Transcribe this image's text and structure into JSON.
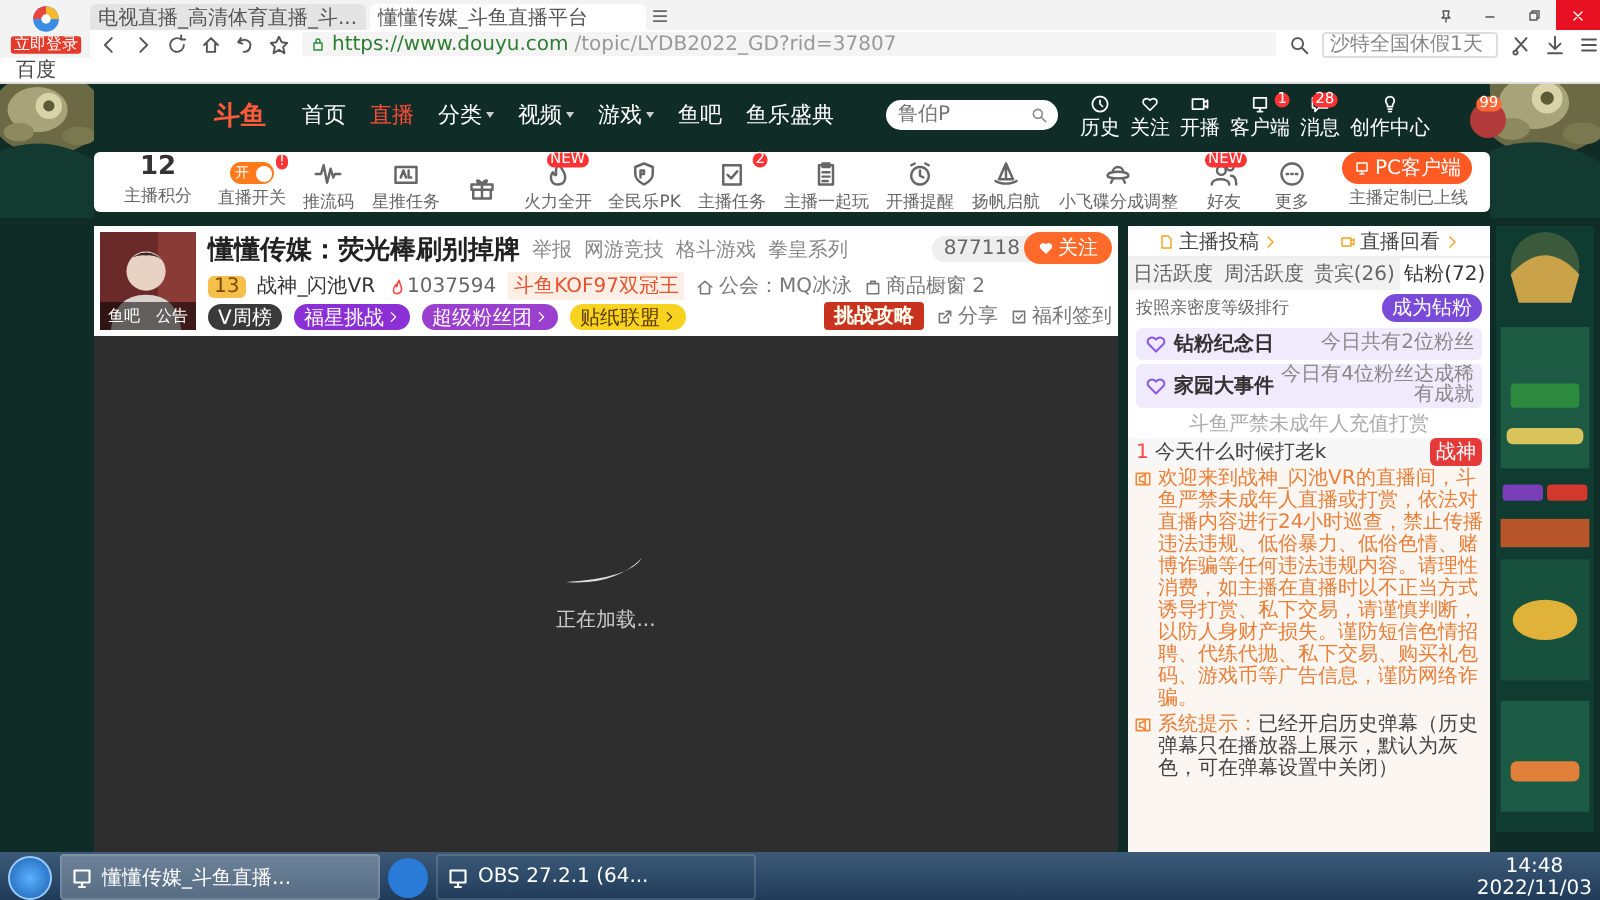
{
  "browser": {
    "login": "立即登录",
    "tabs": [
      {
        "title": "电视直播_高清体育直播_斗...",
        "selected": false
      },
      {
        "title": "懂懂传媒_斗鱼直播平台",
        "selected": true
      }
    ],
    "url": {
      "host": "https://www.douyu.com",
      "path": "/topic/LYDB2022_GD?rid=37807"
    },
    "search": {
      "placeholder": "沙特全国休假1天"
    },
    "bookmarks": [
      "百度"
    ]
  },
  "site": {
    "logo": "斗鱼",
    "nav": [
      {
        "label": "首页",
        "selected": false,
        "dropdown": false
      },
      {
        "label": "直播",
        "selected": true,
        "dropdown": false
      },
      {
        "label": "分类",
        "selected": false,
        "dropdown": true
      },
      {
        "label": "视频",
        "selected": false,
        "dropdown": true
      },
      {
        "label": "游戏",
        "selected": false,
        "dropdown": true
      },
      {
        "label": "鱼吧",
        "selected": false,
        "dropdown": false
      },
      {
        "label": "鱼乐盛典",
        "selected": false,
        "dropdown": false
      }
    ],
    "search": {
      "placeholder": "鲁伯P"
    },
    "actions": [
      {
        "kind": "clock",
        "label": "历史"
      },
      {
        "kind": "heart",
        "label": "关注"
      },
      {
        "kind": "camera",
        "label": "开播"
      },
      {
        "kind": "device",
        "label": "客户端",
        "badge": "1"
      },
      {
        "kind": "message",
        "label": "消息",
        "badge": "28"
      },
      {
        "kind": "bulb",
        "label": "创作中心"
      }
    ],
    "avatar_badge": "99"
  },
  "toolbar": {
    "score": {
      "value": "12",
      "label": "主播积分"
    },
    "items": [
      {
        "kind": "toggle",
        "label": "直播开关",
        "toggle_text": "开",
        "on": true,
        "badge": "!"
      },
      {
        "kind": "wave",
        "label": "推流码"
      },
      {
        "kind": "ad",
        "label": "星推任务"
      },
      {
        "kind": "gift"
      },
      {
        "kind": "flame",
        "label": "火力全开",
        "badge": "NEW"
      },
      {
        "kind": "pk",
        "label": "全民乐PK"
      },
      {
        "kind": "task",
        "label": "主播任务",
        "badge": "2"
      },
      {
        "kind": "clipboard",
        "label": "主播一起玩"
      },
      {
        "kind": "alarm",
        "label": "开播提醒"
      },
      {
        "kind": "sail",
        "label": "扬帆启航"
      },
      {
        "kind": "ufo",
        "label": "小飞碟分成调整"
      },
      {
        "kind": "friends",
        "label": "好友",
        "badge": "NEW"
      },
      {
        "kind": "more",
        "label": "更多"
      }
    ],
    "client_button": "PC客户端",
    "client_note": "主播定制已上线"
  },
  "room": {
    "avatar_links": [
      "鱼吧",
      "公告"
    ],
    "title": "懂懂传媒：荧光棒刷别掉牌",
    "report": "举报",
    "categories": [
      "网游竞技",
      "格斗游戏",
      "拳皇系列"
    ],
    "level": "13",
    "anchor": "战神_闪池VR",
    "heat": "1037594",
    "honor": "斗鱼KOF97双冠王",
    "guild": "公会：MQ冰泳",
    "shop": "商品橱窗 2",
    "badges": [
      {
        "label": "V周榜",
        "color": "#3a3a3a",
        "arrow": false
      },
      {
        "label": "福星挑战",
        "color": "#8b2fd6",
        "arrow": true
      },
      {
        "label": "超级粉丝团",
        "color": "#9b3fcf",
        "arrow": true
      },
      {
        "label": "贴纸联盟",
        "color": "#f7d21e",
        "arrow": true
      }
    ],
    "followers": "877118",
    "follow": "关注",
    "challenge": "挑战攻略",
    "share": "分享",
    "checkin": "福利签到",
    "video": {
      "status": "正在加载..."
    }
  },
  "chat": {
    "links": [
      "主播投稿",
      "直播回看"
    ],
    "tabs": [
      {
        "label": "日活跃度",
        "selected": false
      },
      {
        "label": "周活跃度",
        "selected": false
      },
      {
        "label": "贵宾(26)",
        "selected": false
      },
      {
        "label": "钻粉(72)",
        "selected": true
      }
    ],
    "rank_note": "按照亲密度等级排行",
    "join": "成为钻粉",
    "events": [
      {
        "title": "钻粉纪念日",
        "note": "今日共有2位粉丝"
      },
      {
        "title": "家园大事件",
        "note": "今日有4位粉丝达成稀有成就"
      }
    ],
    "notice": "斗鱼严禁未成年人充值打赏",
    "pinned": {
      "rank": "1",
      "text": "今天什么时候打老k",
      "tag": "战神"
    },
    "messages": [
      {
        "kind": "welcome",
        "text": "欢迎来到战神_闪池VR的直播间，斗鱼严禁未成年人直播或打赏，依法对直播内容进行24小时巡查，禁止传播违法违规、低俗暴力、低俗色情、赌博诈骗等任何违法违规内容。请理性消费，如主播在直播时以不正当方式诱导打赏、私下交易，请谨慎判断，以防人身财产损失。谨防短信色情招聘、代练代抛、私下交易、购买礼包码、游戏币等广告信息，谨防网络诈骗。"
      },
      {
        "kind": "system",
        "label": "系统提示：",
        "text": "已经开启历史弹幕（历史弹幕只在播放器上展示，默认为灰色，可在弹幕设置中关闭）"
      }
    ]
  },
  "taskbar": {
    "items": [
      {
        "label": "懂懂传媒_斗鱼直播...",
        "selected": true
      },
      {
        "label": "OBS 27.2.1 (64...",
        "selected": false
      }
    ],
    "time": "14:48",
    "date": "2022/11/03"
  }
}
